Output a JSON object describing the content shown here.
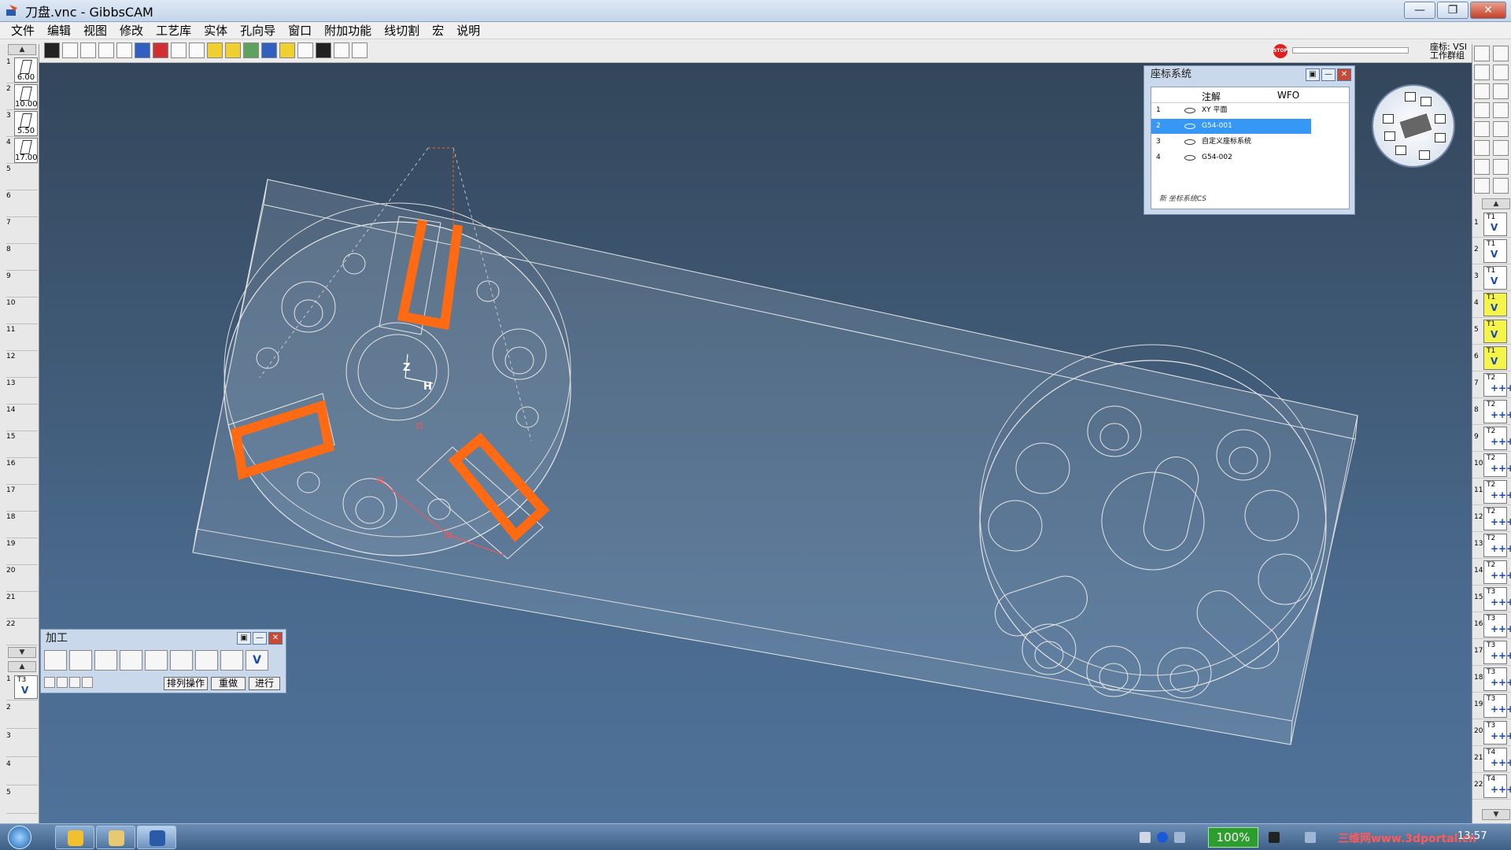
{
  "window": {
    "title": "刀盘.vnc - GibbsCAM",
    "min": "—",
    "max": "❐",
    "close": "✕"
  },
  "menu": [
    "文件",
    "编辑",
    "视图",
    "修改",
    "工艺库",
    "实体",
    "孔向导",
    "窗口",
    "附加功能",
    "线切割",
    "宏",
    "说明"
  ],
  "toolbar": {
    "stop": "STOP",
    "coord_line1": "座标: VSI",
    "coord_line2": "工作群组"
  },
  "left_tools": [
    {
      "num": "1",
      "value": "6.00"
    },
    {
      "num": "2",
      "value": "10.00"
    },
    {
      "num": "3",
      "value": "5.50"
    },
    {
      "num": "4",
      "value": "17.00"
    },
    {
      "num": "5",
      "value": ""
    },
    {
      "num": "6",
      "value": ""
    },
    {
      "num": "7",
      "value": ""
    },
    {
      "num": "8",
      "value": ""
    },
    {
      "num": "9",
      "value": ""
    },
    {
      "num": "10",
      "value": ""
    },
    {
      "num": "11",
      "value": ""
    },
    {
      "num": "12",
      "value": ""
    },
    {
      "num": "13",
      "value": ""
    },
    {
      "num": "14",
      "value": ""
    },
    {
      "num": "15",
      "value": ""
    },
    {
      "num": "16",
      "value": ""
    },
    {
      "num": "17",
      "value": ""
    },
    {
      "num": "18",
      "value": ""
    },
    {
      "num": "19",
      "value": ""
    },
    {
      "num": "20",
      "value": ""
    },
    {
      "num": "21",
      "value": ""
    },
    {
      "num": "22",
      "value": ""
    }
  ],
  "left_ops": [
    {
      "num": "1",
      "tool": "T3",
      "mark": "V"
    },
    {
      "num": "2"
    },
    {
      "num": "3"
    },
    {
      "num": "4"
    },
    {
      "num": "5"
    }
  ],
  "right_ops": [
    {
      "num": "1",
      "tool": "T1",
      "mark": "V",
      "highlight": false
    },
    {
      "num": "2",
      "tool": "T1",
      "mark": "V",
      "highlight": false
    },
    {
      "num": "3",
      "tool": "T1",
      "mark": "V",
      "highlight": false
    },
    {
      "num": "4",
      "tool": "T1",
      "mark": "V",
      "highlight": true
    },
    {
      "num": "5",
      "tool": "T1",
      "mark": "V",
      "highlight": true
    },
    {
      "num": "6",
      "tool": "T1",
      "mark": "V",
      "highlight": true
    },
    {
      "num": "7",
      "tool": "T2",
      "mark": "+++",
      "highlight": false
    },
    {
      "num": "8",
      "tool": "T2",
      "mark": "+++",
      "highlight": false
    },
    {
      "num": "9",
      "tool": "T2",
      "mark": "+++",
      "highlight": false
    },
    {
      "num": "10",
      "tool": "T2",
      "mark": "+++",
      "highlight": false
    },
    {
      "num": "11",
      "tool": "T2",
      "mark": "+++",
      "highlight": false
    },
    {
      "num": "12",
      "tool": "T2",
      "mark": "+++",
      "highlight": false
    },
    {
      "num": "13",
      "tool": "T2",
      "mark": "+++",
      "highlight": false
    },
    {
      "num": "14",
      "tool": "T2",
      "mark": "+++",
      "highlight": false
    },
    {
      "num": "15",
      "tool": "T3",
      "mark": "+++",
      "highlight": false
    },
    {
      "num": "16",
      "tool": "T3",
      "mark": "+++",
      "highlight": false
    },
    {
      "num": "17",
      "tool": "T3",
      "mark": "+++",
      "highlight": false
    },
    {
      "num": "18",
      "tool": "T3",
      "mark": "+++",
      "highlight": false
    },
    {
      "num": "19",
      "tool": "T3",
      "mark": "+++",
      "highlight": false
    },
    {
      "num": "20",
      "tool": "T3",
      "mark": "+++",
      "highlight": false
    },
    {
      "num": "21",
      "tool": "T4",
      "mark": "+++",
      "highlight": false
    },
    {
      "num": "22",
      "tool": "T4",
      "mark": "+++",
      "highlight": false
    }
  ],
  "coord_panel": {
    "title": "座标系统",
    "col_note": "注解",
    "col_wfo": "WFO",
    "rows": [
      {
        "num": "1",
        "label": "XY 平面",
        "selected": false
      },
      {
        "num": "2",
        "label": "G54-001",
        "selected": true
      },
      {
        "num": "3",
        "label": "自定义座标系统",
        "selected": false
      },
      {
        "num": "4",
        "label": "G54-002",
        "selected": false
      }
    ],
    "new_label": "新 坐标系统CS"
  },
  "machining_panel": {
    "title": "加工",
    "sort_label": "排列操作",
    "redo_label": "重做",
    "run_label": "进行"
  },
  "axis_labels": {
    "z": "Z",
    "h": "H"
  },
  "taskbar": {
    "zoom": "100%",
    "watermark": "三维网www.3dportal.cn",
    "clock": "13:57"
  },
  "colors": {
    "toolpath": "#ff6a13",
    "wire": "#e6e6e6",
    "selection": "#3797f5",
    "highlight_op": "#f4f44a"
  }
}
